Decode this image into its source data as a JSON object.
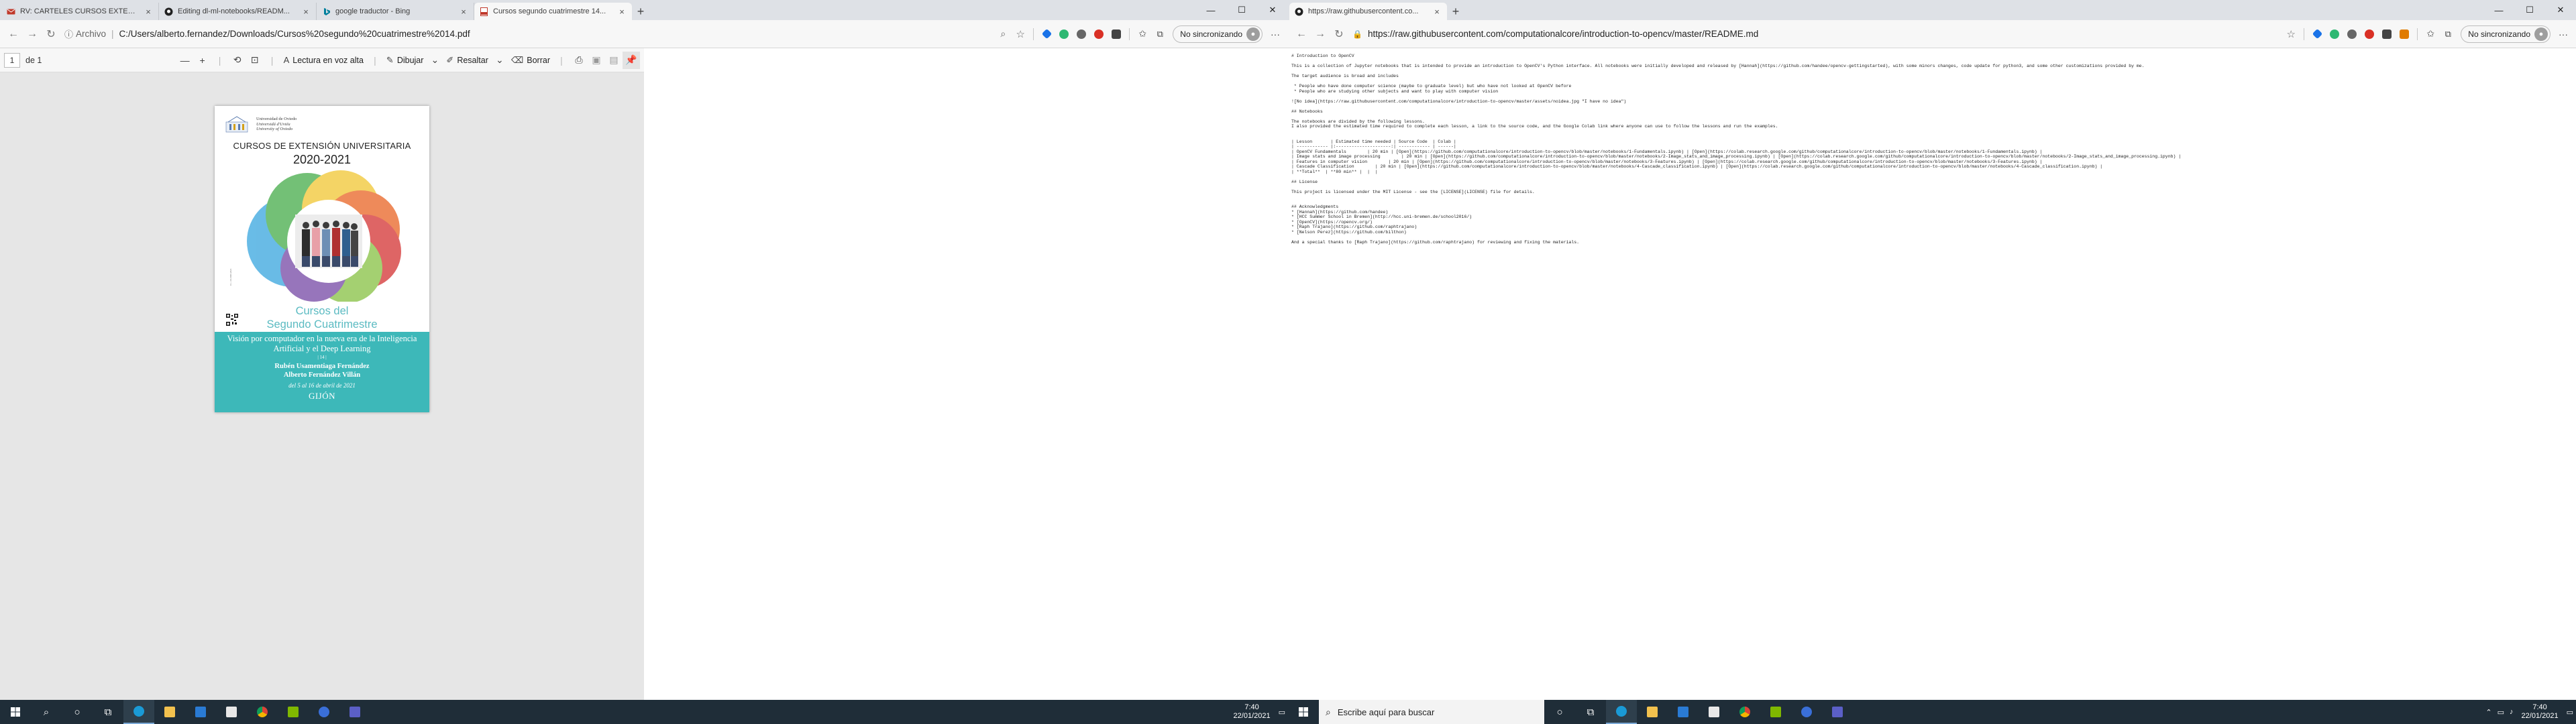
{
  "left_window": {
    "tabs": [
      {
        "title": "RV: CARTELES CURSOS EXTENSI..."
      },
      {
        "title": "Editing dl-ml-notebooks/READM..."
      },
      {
        "title": "google traductor - Bing"
      },
      {
        "title": "Cursos segundo cuatrimestre 14..."
      }
    ],
    "active_tab": 3,
    "address": {
      "label": "Archivo",
      "url": "C:/Users/alberto.fernandez/Downloads/Cursos%20segundo%20cuatrimestre%2014.pdf"
    },
    "sync_label": "No sincronizando",
    "pdf_toolbar": {
      "page_number": "1",
      "page_total": "de 1",
      "read_aloud": "Lectura en voz alta",
      "draw": "Dibujar",
      "highlight": "Resaltar",
      "erase": "Borrar"
    },
    "pdf_page": {
      "university": [
        "Universidad de Oviedo",
        "Universidá d'Uviéu",
        "University of Oviedo"
      ],
      "title": "CURSOS DE EXTENSIÓN UNIVERSITARIA",
      "year": "2020-2021",
      "cursos_line1": "Cursos del",
      "cursos_line2": "Segundo Cuatrimestre",
      "course_title": "Visión por computador en la nueva era de la Inteligencia Artificial y el Deep Learning",
      "course_number": "| 14 |",
      "author1": "Rubén Usamentiaga Fernández",
      "author2": "Alberto Fernández Villán",
      "dates": "del 5 al 16 de abril de 2021",
      "city": "GIJÓN",
      "vertical_code": "D.L. AS-0000-2021"
    }
  },
  "right_window": {
    "tabs": [
      {
        "title": "https://raw.githubusercontent.co..."
      }
    ],
    "url": "https://raw.githubusercontent.com/computationalcore/introduction-to-opencv/master/README.md",
    "sync_label": "No sincronizando",
    "raw_text": "# Introduction to OpenCV\n\nThis is a collection of Jupyter notebooks that is intended to provide an introduction to OpenCV's Python interface. All notebooks were initially developed and released by [Hannah](https://github.com/handee/opencv-gettingstarted), with some minors changes, code update for python3, and some other customizations provided by me.\n\nThe target audience is broad and includes\n\n * People who have done computer science (maybe to graduate level) but who have not looked at OpenCV before\n * People who are studying other subjects and want to play with computer vision\n\n![No idea](https://raw.githubusercontent.com/computationalcore/introduction-to-opencv/master/assets/noidea.jpg \"I have no idea\")\n\n## Notebooks\n\nThe notebooks are divided by the following lessons.\nI also provided the estimated time required to complete each lesson, a link to the source code, and the Google Colab link where anyone can use to follow the lessons and run the examples.\n\n\n| Lesson       | Estimated time needed | Source Code  | Colab |\n| ------------ |:---------------------:| ------------ | ------|\n| OpenCV Fundamentals        | 20 min | [Open](https://github.com/computationalcore/introduction-to-opencv/blob/master/notebooks/1-Fundamentals.ipynb) | [Open](https://colab.research.google.com/github/computationalcore/introduction-to-opencv/blob/master/notebooks/1-Fundamentals.ipynb) |\n| Image stats and image processing        | 20 min | [Open](https://github.com/computationalcore/introduction-to-opencv/blob/master/notebooks/2-Image_stats_and_image_processing.ipynb) | [Open](https://colab.research.google.com/github/computationalcore/introduction-to-opencv/blob/master/notebooks/2-Image_stats_and_image_processing.ipynb) |\n| Features in computer vision        | 20 min | [Open](https://github.com/computationalcore/introduction-to-opencv/blob/master/notebooks/3-Features.ipynb) | [Open](https://colab.research.google.com/github/computationalcore/introduction-to-opencv/blob/master/notebooks/3-Features.ipynb) |\n| Cascade Classification        | 20 min | [Open](https://github.com/computationalcore/introduction-to-opencv/blob/master/notebooks/4-Cascade_classification.ipynb) | [Open](https://colab.research.google.com/github/computationalcore/introduction-to-opencv/blob/master/notebooks/4-Cascade_classification.ipynb) |\n| **Total**  | **80 min** |  |  |\n\n## License\n\nThis project is licensed under the MIT License - see the [LICENSE](LICENSE) file for details.\n\n\n## Acknowledgments\n* [Hannah](https://github.com/handee)\n* [HCC Summer School in Bremen](http://hcc.uni-bremen.de/school2016/)\n* [OpenCV](https://opencv.org/)\n* [Raph Trajano](https://github.com/raphtrajano)\n* [Nelson Perez](https://github.com/bilthon)\n\nAnd a special thanks to [Raph Trajano](https://github.com/raphtrajano) for reviewing and fixing the materials."
  },
  "taskbar_left": {
    "time": "7:40",
    "date": "22/01/2021"
  },
  "taskbar_right": {
    "search_placeholder": "Escribe aquí para buscar",
    "time": "7:40",
    "date": "22/01/2021"
  },
  "colors": {
    "teal": "#3db8b9",
    "taskbar": "#1f2d38",
    "tab_bg": "#dee1e6"
  }
}
